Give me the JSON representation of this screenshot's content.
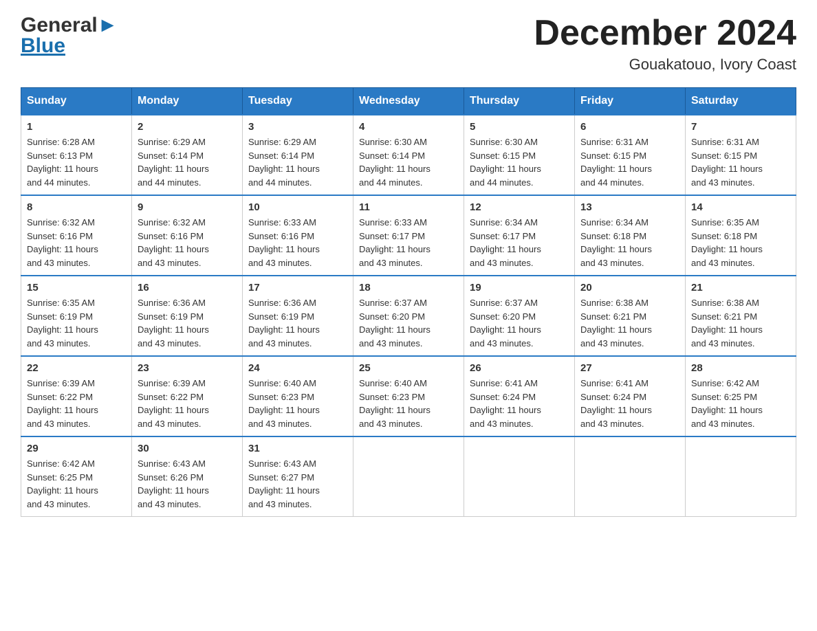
{
  "logo": {
    "part1": "General",
    "part2": "Blue"
  },
  "header": {
    "month": "December 2024",
    "location": "Gouakatouo, Ivory Coast"
  },
  "weekdays": [
    "Sunday",
    "Monday",
    "Tuesday",
    "Wednesday",
    "Thursday",
    "Friday",
    "Saturday"
  ],
  "weeks": [
    [
      {
        "day": "1",
        "sunrise": "6:28 AM",
        "sunset": "6:13 PM",
        "daylight": "11 hours and 44 minutes."
      },
      {
        "day": "2",
        "sunrise": "6:29 AM",
        "sunset": "6:14 PM",
        "daylight": "11 hours and 44 minutes."
      },
      {
        "day": "3",
        "sunrise": "6:29 AM",
        "sunset": "6:14 PM",
        "daylight": "11 hours and 44 minutes."
      },
      {
        "day": "4",
        "sunrise": "6:30 AM",
        "sunset": "6:14 PM",
        "daylight": "11 hours and 44 minutes."
      },
      {
        "day": "5",
        "sunrise": "6:30 AM",
        "sunset": "6:15 PM",
        "daylight": "11 hours and 44 minutes."
      },
      {
        "day": "6",
        "sunrise": "6:31 AM",
        "sunset": "6:15 PM",
        "daylight": "11 hours and 44 minutes."
      },
      {
        "day": "7",
        "sunrise": "6:31 AM",
        "sunset": "6:15 PM",
        "daylight": "11 hours and 43 minutes."
      }
    ],
    [
      {
        "day": "8",
        "sunrise": "6:32 AM",
        "sunset": "6:16 PM",
        "daylight": "11 hours and 43 minutes."
      },
      {
        "day": "9",
        "sunrise": "6:32 AM",
        "sunset": "6:16 PM",
        "daylight": "11 hours and 43 minutes."
      },
      {
        "day": "10",
        "sunrise": "6:33 AM",
        "sunset": "6:16 PM",
        "daylight": "11 hours and 43 minutes."
      },
      {
        "day": "11",
        "sunrise": "6:33 AM",
        "sunset": "6:17 PM",
        "daylight": "11 hours and 43 minutes."
      },
      {
        "day": "12",
        "sunrise": "6:34 AM",
        "sunset": "6:17 PM",
        "daylight": "11 hours and 43 minutes."
      },
      {
        "day": "13",
        "sunrise": "6:34 AM",
        "sunset": "6:18 PM",
        "daylight": "11 hours and 43 minutes."
      },
      {
        "day": "14",
        "sunrise": "6:35 AM",
        "sunset": "6:18 PM",
        "daylight": "11 hours and 43 minutes."
      }
    ],
    [
      {
        "day": "15",
        "sunrise": "6:35 AM",
        "sunset": "6:19 PM",
        "daylight": "11 hours and 43 minutes."
      },
      {
        "day": "16",
        "sunrise": "6:36 AM",
        "sunset": "6:19 PM",
        "daylight": "11 hours and 43 minutes."
      },
      {
        "day": "17",
        "sunrise": "6:36 AM",
        "sunset": "6:19 PM",
        "daylight": "11 hours and 43 minutes."
      },
      {
        "day": "18",
        "sunrise": "6:37 AM",
        "sunset": "6:20 PM",
        "daylight": "11 hours and 43 minutes."
      },
      {
        "day": "19",
        "sunrise": "6:37 AM",
        "sunset": "6:20 PM",
        "daylight": "11 hours and 43 minutes."
      },
      {
        "day": "20",
        "sunrise": "6:38 AM",
        "sunset": "6:21 PM",
        "daylight": "11 hours and 43 minutes."
      },
      {
        "day": "21",
        "sunrise": "6:38 AM",
        "sunset": "6:21 PM",
        "daylight": "11 hours and 43 minutes."
      }
    ],
    [
      {
        "day": "22",
        "sunrise": "6:39 AM",
        "sunset": "6:22 PM",
        "daylight": "11 hours and 43 minutes."
      },
      {
        "day": "23",
        "sunrise": "6:39 AM",
        "sunset": "6:22 PM",
        "daylight": "11 hours and 43 minutes."
      },
      {
        "day": "24",
        "sunrise": "6:40 AM",
        "sunset": "6:23 PM",
        "daylight": "11 hours and 43 minutes."
      },
      {
        "day": "25",
        "sunrise": "6:40 AM",
        "sunset": "6:23 PM",
        "daylight": "11 hours and 43 minutes."
      },
      {
        "day": "26",
        "sunrise": "6:41 AM",
        "sunset": "6:24 PM",
        "daylight": "11 hours and 43 minutes."
      },
      {
        "day": "27",
        "sunrise": "6:41 AM",
        "sunset": "6:24 PM",
        "daylight": "11 hours and 43 minutes."
      },
      {
        "day": "28",
        "sunrise": "6:42 AM",
        "sunset": "6:25 PM",
        "daylight": "11 hours and 43 minutes."
      }
    ],
    [
      {
        "day": "29",
        "sunrise": "6:42 AM",
        "sunset": "6:25 PM",
        "daylight": "11 hours and 43 minutes."
      },
      {
        "day": "30",
        "sunrise": "6:43 AM",
        "sunset": "6:26 PM",
        "daylight": "11 hours and 43 minutes."
      },
      {
        "day": "31",
        "sunrise": "6:43 AM",
        "sunset": "6:27 PM",
        "daylight": "11 hours and 43 minutes."
      },
      null,
      null,
      null,
      null
    ]
  ],
  "labels": {
    "sunrise": "Sunrise:",
    "sunset": "Sunset:",
    "daylight": "Daylight:"
  }
}
